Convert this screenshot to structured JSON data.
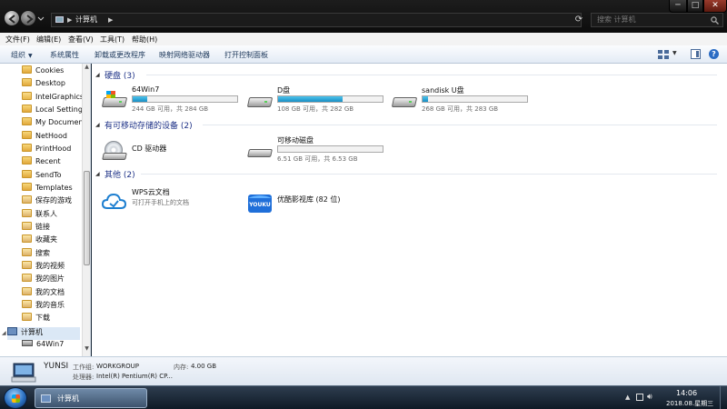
{
  "window": {
    "address_crumb": "计算机",
    "search_placeholder": "搜索 计算机",
    "controls": {
      "minimize": "─",
      "maximize": "□",
      "close": "✕"
    }
  },
  "menu": [
    "文件(F)",
    "编辑(E)",
    "查看(V)",
    "工具(T)",
    "帮助(H)"
  ],
  "toolbar": {
    "organize": "组织",
    "system_properties": "系统属性",
    "uninstall": "卸载或更改程序",
    "map_drive": "映射网络驱动器",
    "control_panel": "打开控制面板"
  },
  "nav": {
    "items": [
      "Cookies",
      "Desktop",
      "IntelGraphicsP",
      "Local Settings",
      "My Documents",
      "NetHood",
      "PrintHood",
      "Recent",
      "SendTo",
      "Templates",
      "保存的游戏",
      "联系人",
      "链接",
      "收藏夹",
      "搜索",
      "我的视频",
      "我的图片",
      "我的文档",
      "我的音乐",
      "下载"
    ],
    "computer": "计算机",
    "drive": "64Win7"
  },
  "groups": {
    "hard_disks": "硬盘 (3)",
    "removable": "有可移动存储的设备 (2)",
    "other": "其他 (2)"
  },
  "drives": [
    {
      "name": "64Win7",
      "size_text": "244 GB 可用，共 284 GB",
      "used_fraction": 0.14,
      "type": "system"
    },
    {
      "name": "D盘",
      "size_text": "108 GB 可用，共 282 GB",
      "used_fraction": 0.62,
      "type": "hdd"
    },
    {
      "name": "sandisk U盘",
      "size_text": "268 GB 可用，共 283 GB",
      "used_fraction": 0.05,
      "type": "hdd"
    }
  ],
  "removable": [
    {
      "name": "CD 驱动器",
      "type": "cd"
    },
    {
      "name": "可移动磁盘",
      "size_text": "6.51 GB 可用，共 6.53 GB",
      "used_fraction": 0.0,
      "type": "usb"
    }
  ],
  "other": [
    {
      "name": "WPS云文档",
      "sub": "可打开手机上的文档",
      "icon": "cloud-icon"
    },
    {
      "name": "优酷影视库 (82 位)",
      "icon": "youku-icon",
      "icon_text": "YOUKU"
    }
  ],
  "details": {
    "name": "YUNSI",
    "workgroup_label": "工作组:",
    "workgroup": "WORKGROUP",
    "memory_label": "内存:",
    "memory": "4.00 GB",
    "cpu_label": "处理器:",
    "cpu": "Intel(R) Pentium(R) CP..."
  },
  "taskbar": {
    "window_label": "计算机",
    "time": "14:06",
    "date": "2018.08.星期三"
  }
}
